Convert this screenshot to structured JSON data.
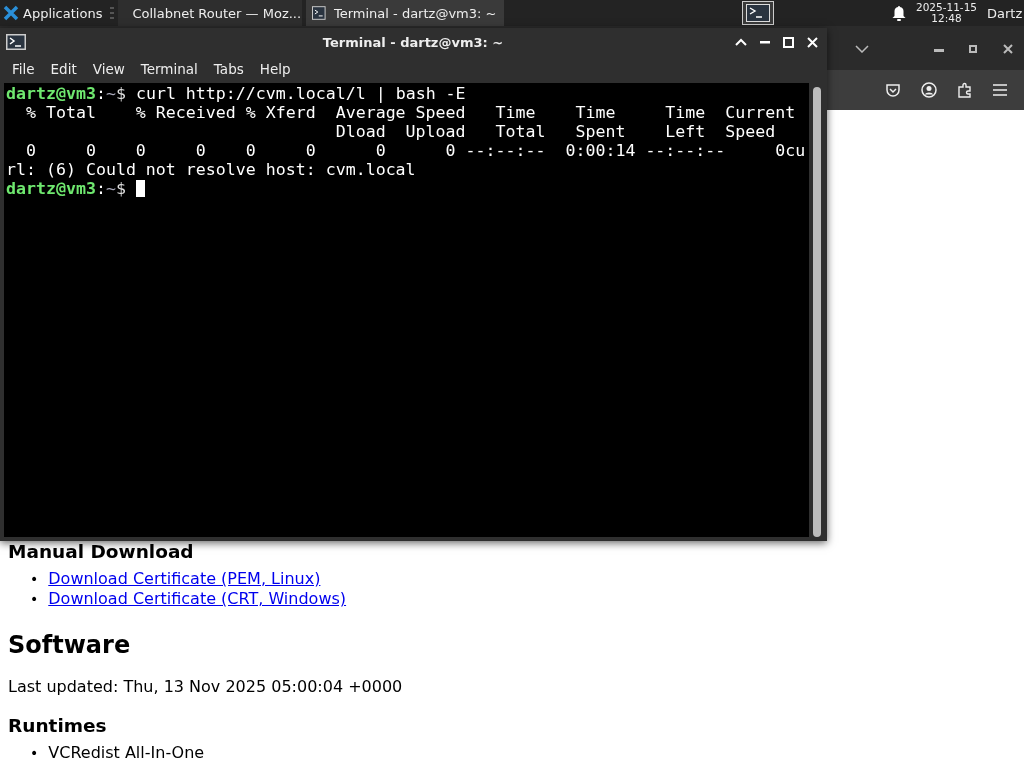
{
  "taskbar": {
    "menu_label": "Applications",
    "tasks": [
      {
        "kind": "browser",
        "label": "Collabnet Router — Moz...",
        "selected": false
      },
      {
        "kind": "terminal",
        "label": "Terminal - dartz@vm3: ~",
        "selected": true
      }
    ],
    "date": "2025-11-15",
    "time": "12:48",
    "user": "Dartz"
  },
  "browser": {
    "page": {
      "sections": [
        {
          "kind": "subheading",
          "text": "Manual Download"
        },
        {
          "kind": "links",
          "marker": "•",
          "items": [
            "Download Certificate (PEM, Linux)",
            "Download Certificate (CRT, Windows)"
          ]
        },
        {
          "kind": "heading",
          "text": "Software"
        },
        {
          "kind": "paragraph",
          "text": "Last updated: Thu, 13 Nov 2025 05:00:04 +0000"
        },
        {
          "kind": "subheading",
          "text": "Runtimes"
        },
        {
          "kind": "bullets",
          "marker": "•",
          "items": [
            "VCRedist All-In-One"
          ]
        }
      ]
    }
  },
  "terminal": {
    "title": "Terminal - dartz@vm3: ~",
    "menu": [
      "File",
      "Edit",
      "View",
      "Terminal",
      "Tabs",
      "Help"
    ],
    "lines": [
      {
        "kind": "prompt",
        "user_host": "dartz@vm3",
        "separator": ":",
        "path": "~",
        "symbol": "$",
        "command": "curl http://cvm.local/l | bash -E",
        "cursor": false
      },
      {
        "kind": "output",
        "text": "  % Total    % Received % Xferd  Average Speed   Time    Time     Time  Current"
      },
      {
        "kind": "output",
        "text": "                                 Dload  Upload   Total   Spent    Left  Speed"
      },
      {
        "kind": "output",
        "text": "  0     0    0     0    0     0      0      0 --:--:--  0:00:14 --:--:--     0cu"
      },
      {
        "kind": "output",
        "text": "rl: (6) Could not resolve host: cvm.local"
      },
      {
        "kind": "prompt",
        "user_host": "dartz@vm3",
        "separator": ":",
        "path": "~",
        "symbol": "$",
        "cursor": true
      }
    ]
  }
}
